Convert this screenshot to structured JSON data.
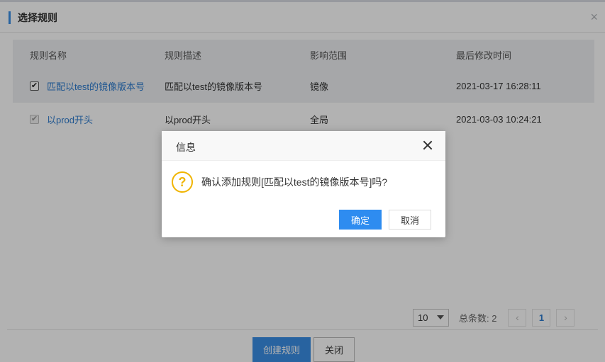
{
  "dialog": {
    "title": "选择规则",
    "close_glyph": "×",
    "columns": [
      "规则名称",
      "规则描述",
      "影响范围",
      "最后修改时间"
    ],
    "rows": [
      {
        "name": "匹配以test的镜像版本号",
        "description": "匹配以test的镜像版本号",
        "scope": "镜像",
        "modified": "2021-03-17 16:28:11",
        "checked": true
      },
      {
        "name": "以prod开头",
        "description": "以prod开头",
        "scope": "全局",
        "modified": "2021-03-03 10:24:21",
        "checked": true
      }
    ],
    "pagination": {
      "page_size": "10",
      "total_label": "总条数: 2",
      "prev_glyph": "‹",
      "current_page": "1",
      "next_glyph": "›"
    },
    "create_button": "创建规则",
    "close_button": "关闭"
  },
  "confirm": {
    "title": "信息",
    "icon": "question-icon",
    "icon_glyph": "?",
    "message": "确认添加规则[匹配以test的镜像版本号]吗?",
    "ok_button": "确定",
    "cancel_button": "取消"
  },
  "colors": {
    "accent": "#3a8ee6",
    "link": "#2d7ccf",
    "warning": "#f0b400"
  }
}
